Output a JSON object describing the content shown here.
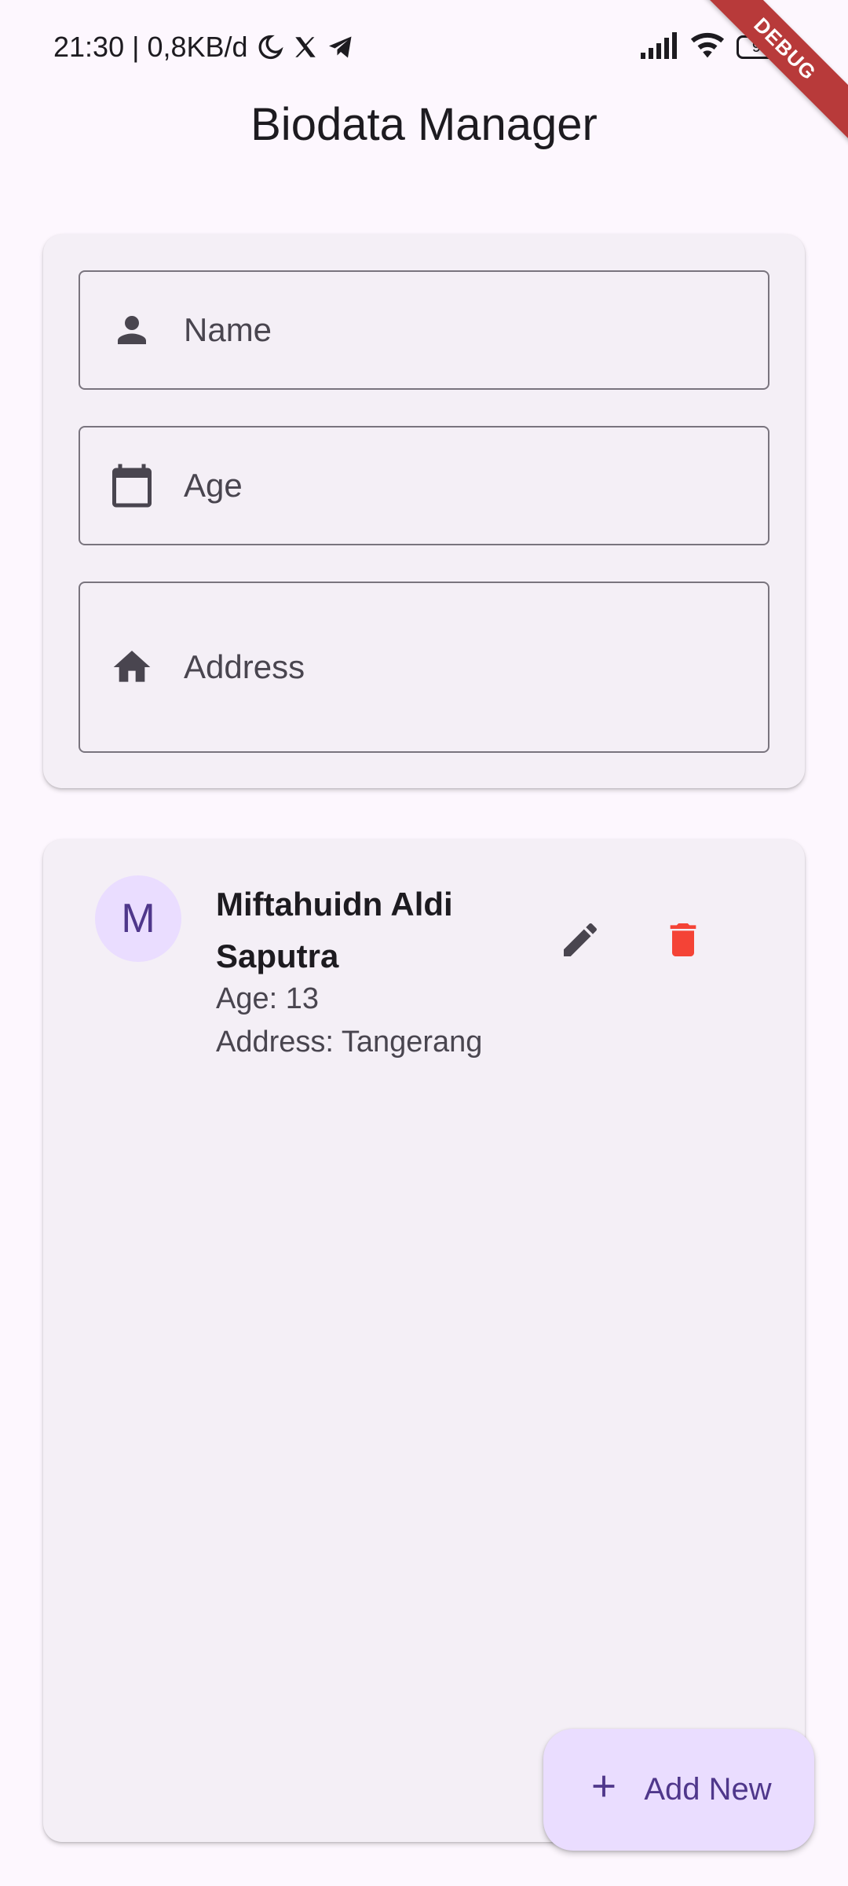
{
  "status_bar": {
    "time_text": "21:30 | 0,8KB/d",
    "battery_level": "95",
    "icons": [
      "moon-icon",
      "x-icon",
      "telegram-icon",
      "signal-icon",
      "wifi-icon",
      "battery-icon"
    ]
  },
  "debug_banner": "DEBUG",
  "app_bar": {
    "title": "Biodata Manager"
  },
  "form": {
    "name_placeholder": "Name",
    "age_placeholder": "Age",
    "address_placeholder": "Address",
    "name_value": "",
    "age_value": "",
    "address_value": ""
  },
  "list": {
    "items": [
      {
        "initial": "M",
        "name": "Miftahuidn Aldi Saputra",
        "age_text": "Age: 13",
        "address_text": "Address: Tangerang"
      }
    ]
  },
  "fab": {
    "label": "Add New"
  },
  "colors": {
    "background": "#fdf7fe",
    "card": "#f4eff6",
    "primary": "#4f378b",
    "primary_container": "#eaddff",
    "delete": "#f44336",
    "debug_banner": "#b83a3a"
  }
}
